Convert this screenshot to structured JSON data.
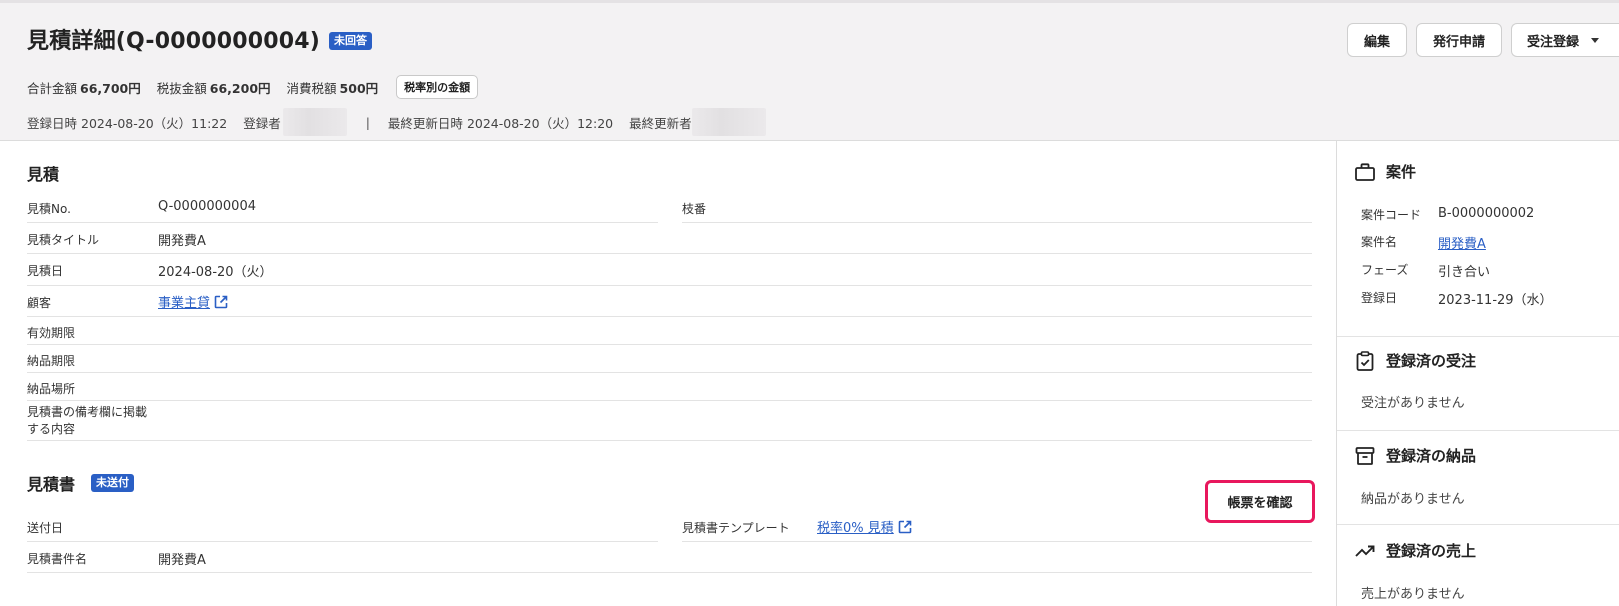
{
  "header": {
    "title": "見積詳細(Q-0000000004)",
    "status_badge": "未回答",
    "amounts": [
      {
        "label": "合計金額",
        "value": "66,700円"
      },
      {
        "label": "税抜金額",
        "value": "66,200円"
      },
      {
        "label": "消費税額",
        "value": "500円"
      }
    ],
    "tax_rate_button": "税率別の金額",
    "registered_label": "登録日時",
    "registered_at": "2024-08-20（火）11:22",
    "registered_by_label": "登録者",
    "separator": "|",
    "updated_label": "最終更新日時",
    "updated_at": "2024-08-20（火）12:20",
    "updated_by_label": "最終更新者",
    "actions": {
      "edit": "編集",
      "apply": "発行申請",
      "order": "受注登録"
    }
  },
  "estimate": {
    "section_title": "見積",
    "fields": [
      {
        "label": "見積No.",
        "value": "Q-0000000004"
      },
      {
        "label": "見積タイトル",
        "value": "開発費A"
      },
      {
        "label": "見積日",
        "value": "2024-08-20（火）"
      },
      {
        "label": "顧客",
        "value": "事業主貸"
      },
      {
        "label": "有効期限",
        "value": ""
      },
      {
        "label": "納品期限",
        "value": ""
      },
      {
        "label": "納品場所",
        "value": ""
      },
      {
        "label": "見積書の備考欄に掲載する内容",
        "value": ""
      }
    ],
    "branch_label": "枝番",
    "branch_value": ""
  },
  "document": {
    "section_title": "見積書",
    "badge": "未送付",
    "confirm_button": "帳票を確認",
    "sent_date_label": "送付日",
    "sent_date_value": "",
    "template_label": "見積書テンプレート",
    "template_value": "税率0% 見積",
    "doc_name_label": "見積書件名",
    "doc_name_value": "開発費A"
  },
  "side": {
    "project": {
      "title": "案件",
      "fields": [
        {
          "label": "案件コード",
          "value": "B-0000000002"
        },
        {
          "label": "案件名",
          "value": "開発費A"
        },
        {
          "label": "フェーズ",
          "value": "引き合い"
        },
        {
          "label": "登録日",
          "value": "2023-11-29（水）"
        }
      ]
    },
    "orders": {
      "title": "登録済の受注",
      "empty": "受注がありません"
    },
    "deliveries": {
      "title": "登録済の納品",
      "empty": "納品がありません"
    },
    "sales": {
      "title": "登録済の売上",
      "empty": "売上がありません"
    }
  },
  "colors": {
    "accent": "#2a5fc5",
    "highlight": "#e8175d",
    "header_bg": "#f3f2f3"
  }
}
